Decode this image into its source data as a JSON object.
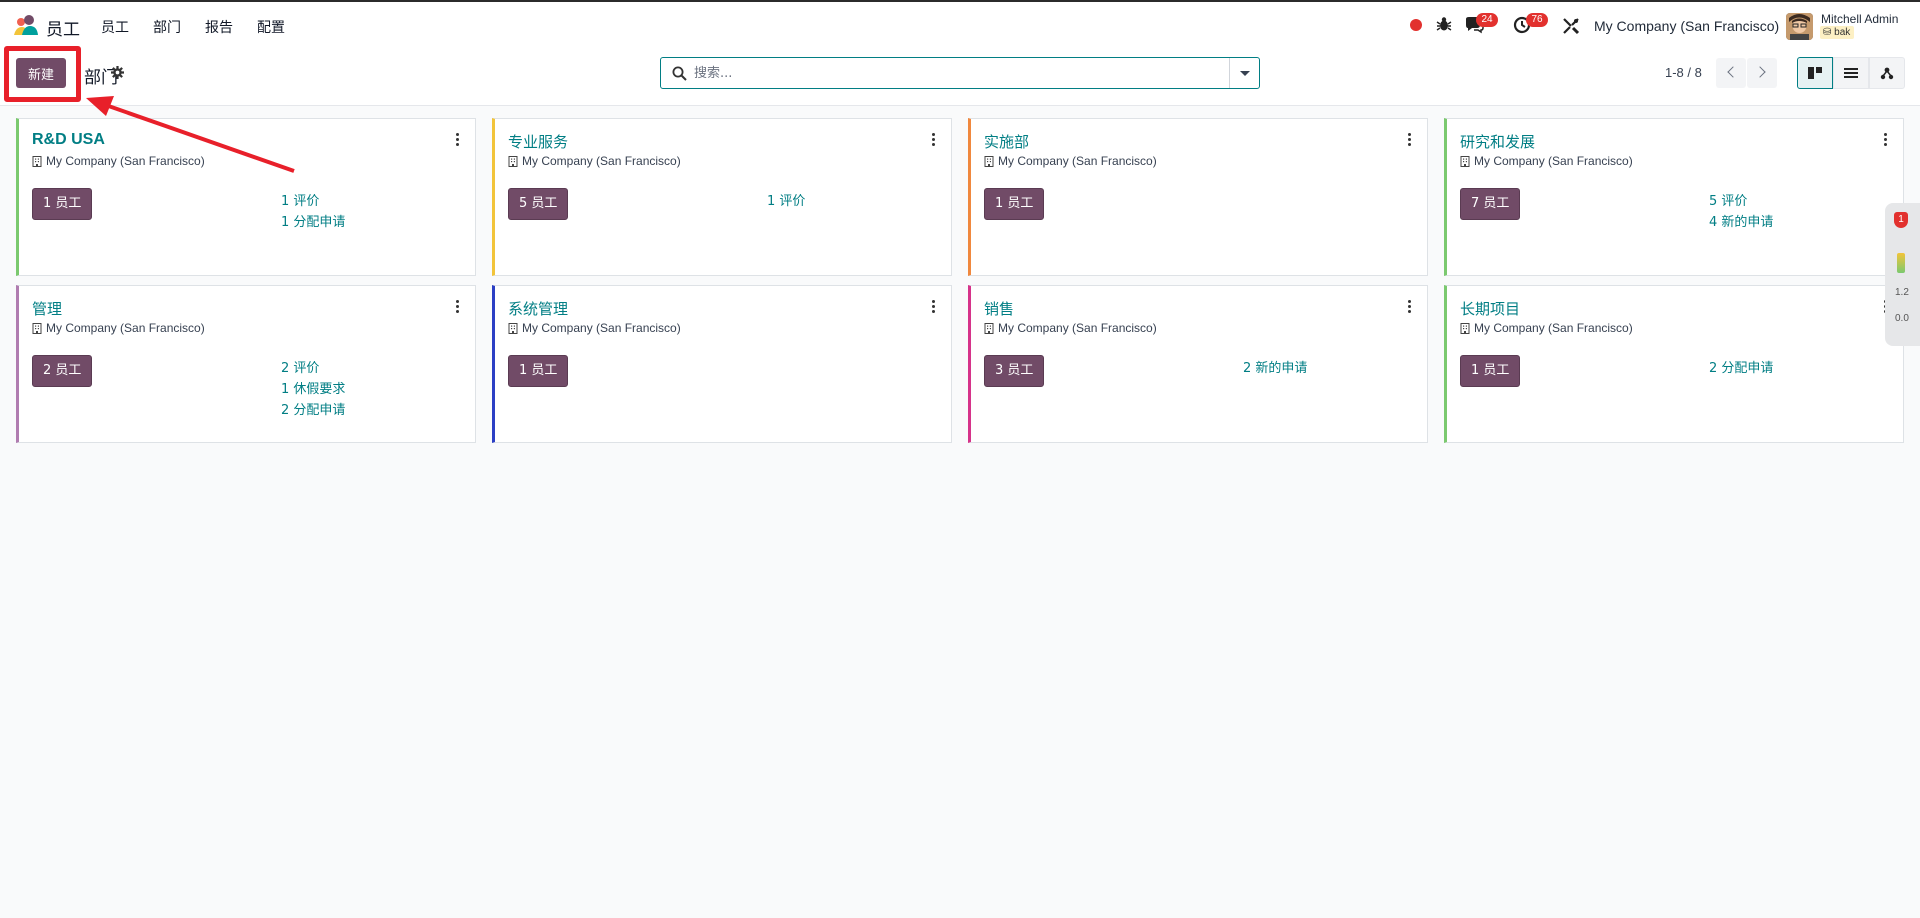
{
  "navbar": {
    "app_name": "员工",
    "menu": [
      "员工",
      "部门",
      "报告",
      "配置"
    ],
    "messages_count": "24",
    "activities_count": "76",
    "company": "My Company (San Francisco)",
    "user_name": "Mitchell Admin",
    "database": "bak"
  },
  "control": {
    "new_label": "新建",
    "breadcrumb": "部门",
    "search_placeholder": "搜索...",
    "pager": "1-8 / 8"
  },
  "cards": [
    {
      "title": "R&D USA",
      "company": "My Company (San Francisco)",
      "employees": "1 员工",
      "links": [
        "1 评价",
        "1 分配申请"
      ],
      "accent": "#7bc96f"
    },
    {
      "title": "专业服务",
      "company": "My Company (San Francisco)",
      "employees": "5 员工",
      "links": [
        "1 评价"
      ],
      "accent": "#f2c43a"
    },
    {
      "title": "实施部",
      "company": "My Company (San Francisco)",
      "employees": "1 员工",
      "links": [],
      "accent": "#f0883e"
    },
    {
      "title": "研究和发展",
      "company": "My Company (San Francisco)",
      "employees": "7 员工",
      "links": [
        "5 评价",
        "4 新的申请"
      ],
      "accent": "#7bc96f"
    },
    {
      "title": "管理",
      "company": "My Company (San Francisco)",
      "employees": "2 员工",
      "links": [
        "2 评价",
        "1 休假要求",
        "2 分配申请"
      ],
      "accent": "#b07cb0"
    },
    {
      "title": "系统管理",
      "company": "My Company (San Francisco)",
      "employees": "1 员工",
      "links": [],
      "accent": "#2c3fc4"
    },
    {
      "title": "销售",
      "company": "My Company (San Francisco)",
      "employees": "3 员工",
      "links": [
        "2 新的申请"
      ],
      "accent": "#d6338a"
    },
    {
      "title": "长期项目",
      "company": "My Company (San Francisco)",
      "employees": "1 员工",
      "links": [
        "2 分配申请"
      ],
      "accent": "#7bc96f"
    }
  ],
  "side_widget": {
    "badge": "1",
    "upload": "1.2",
    "download": "0.0"
  },
  "colors": {
    "brand": "#714b67",
    "link": "#017e84",
    "annotation": "#e8202a"
  }
}
